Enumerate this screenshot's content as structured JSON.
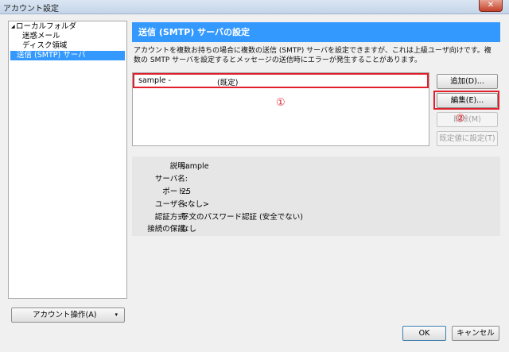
{
  "window": {
    "title": "アカウント設定",
    "close_label": "✕"
  },
  "sidebar": {
    "root": "ローカルフォルダ",
    "items": [
      "迷惑メール",
      "ディスク領域",
      "送信 (SMTP) サーバ"
    ],
    "account_ops_label": "アカウント操作(A)"
  },
  "main": {
    "header": "送信 (SMTP) サーバの設定",
    "description_line1": "アカウントを複数お持ちの場合に複数の送信 (SMTP) サーバを設定できますが、これは上級ユーザ向けです。複",
    "description_line2": "数の SMTP サーバを設定するとメッセージの送信時にエラーが発生することがあります。",
    "server_list": [
      {
        "name": "sample -",
        "default": "(既定)"
      }
    ],
    "annotation_1": "①",
    "annotation_2": "②",
    "buttons": {
      "add": "追加(D)...",
      "edit": "編集(E)...",
      "delete": "削除(M)",
      "set_default": "既定値に設定(T)"
    },
    "details": [
      {
        "label": "説明:",
        "value": "sample"
      },
      {
        "label": "サーバ名:",
        "value": ""
      },
      {
        "label": "ポート:",
        "value": "25"
      },
      {
        "label": "ユーザ名:",
        "value": "<なし>"
      },
      {
        "label": "認証方式:",
        "value": "平文のパスワード認証 (安全でない)"
      },
      {
        "label": "接続の保護:",
        "value": "なし"
      }
    ]
  },
  "footer": {
    "ok": "OK",
    "cancel": "キャンセル"
  },
  "colors": {
    "accent": "#3399ff",
    "highlight": "#e0202a"
  }
}
